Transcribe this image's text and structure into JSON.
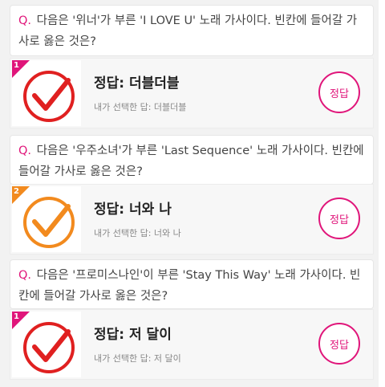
{
  "accent_color": "#e0157a",
  "items": [
    {
      "q_mark": "Q.",
      "question": "다음은 '위너'가 부른 'I LOVE U' 노래 가사이다. 빈칸에 들어갈 가사로 옳은 것은?",
      "number": "1",
      "answer_title": "정답: 더블더블",
      "user_answer": "내가 선택한 답: 더블더블",
      "button_label": "정답",
      "check_color": "#e02020",
      "ribbon_color": "#e0157a"
    },
    {
      "q_mark": "Q.",
      "question": "다음은 '우주소녀'가 부른 'Last Sequence' 노래 가사이다. 빈칸에 들어갈 가사로 옳은 것은?",
      "number": "2",
      "answer_title": "정답: 너와 나",
      "user_answer": "내가 선택한 답: 너와 나",
      "button_label": "정답",
      "check_color": "#f28a1e",
      "ribbon_color": "#f28a1e"
    },
    {
      "q_mark": "Q.",
      "question": "다음은 '프로미스나인'이 부른 'Stay This Way' 노래 가사이다. 빈칸에 들어갈 가사로 옳은 것은?",
      "number": "1",
      "answer_title": "정답: 저 달이",
      "user_answer": "내가 선택한 답: 저 달이",
      "button_label": "정답",
      "check_color": "#e02020",
      "ribbon_color": "#e0157a"
    }
  ]
}
